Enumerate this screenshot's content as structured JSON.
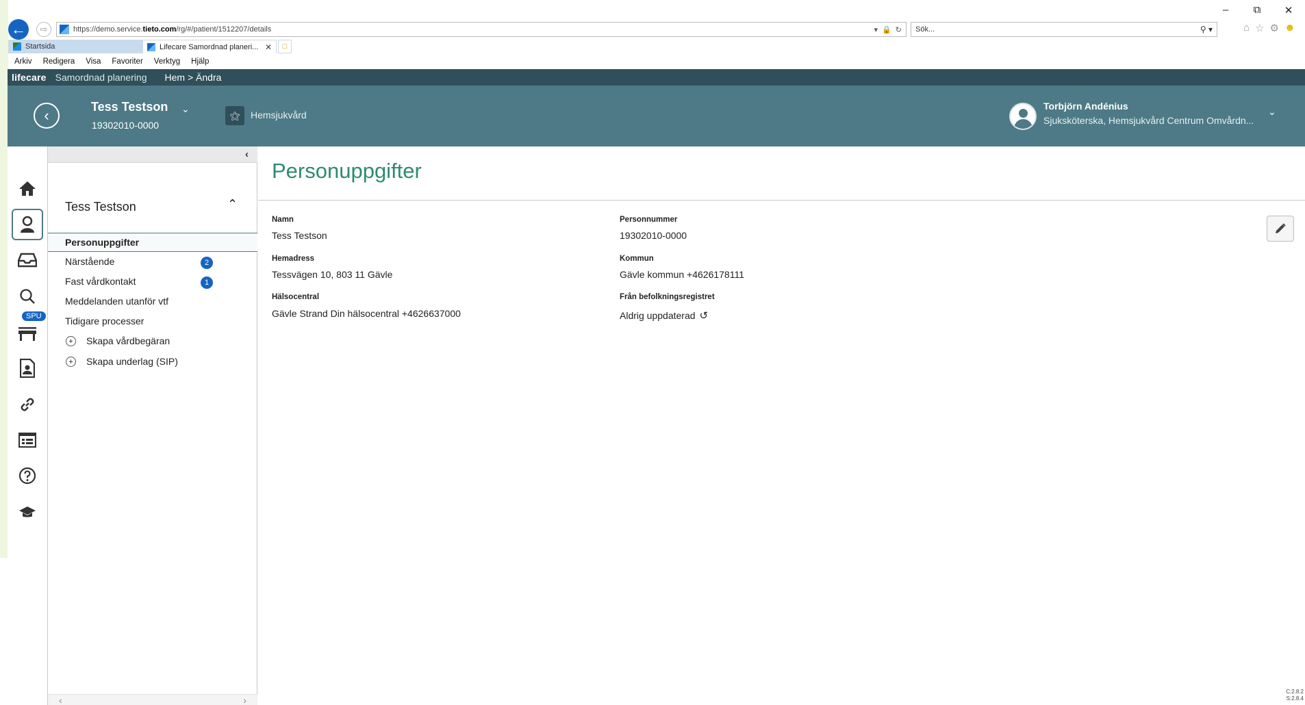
{
  "browser": {
    "url_prefix": "https://demo.service.",
    "url_domain": "tieto.com",
    "url_path": "/rg/#/patient/1512207/details",
    "search_placeholder": "Sök...",
    "tabs": [
      {
        "label": "Startsida"
      },
      {
        "label": "Lifecare Samordnad planeri..."
      }
    ],
    "menu": [
      "Arkiv",
      "Redigera",
      "Visa",
      "Favoriter",
      "Verktyg",
      "Hjälp"
    ]
  },
  "app": {
    "brand": "lifecare",
    "name": "Samordnad planering",
    "breadcrumb": "Hem > Ändra"
  },
  "patient_bar": {
    "name": "Tess Testson",
    "personnummer": "19302010-0000",
    "unit": "Hemsjukvård",
    "user_name": "Torbjörn Andénius",
    "user_role": "Sjuksköterska, Hemsjukvård Centrum Omvårdn..."
  },
  "rail": {
    "spu_badge": "SPU",
    "icons": [
      "home-icon",
      "patient-icon",
      "inbox-icon",
      "search-icon",
      "bed-icon",
      "document-person-icon",
      "link-icon",
      "list-icon",
      "help-icon",
      "graduation-cap-icon"
    ]
  },
  "sidebar": {
    "title": "Tess Testson",
    "items": [
      {
        "label": "Personuppgifter"
      },
      {
        "label": "Närstående",
        "badge": "2"
      },
      {
        "label": "Fast vårdkontakt",
        "badge": "1"
      },
      {
        "label": "Meddelanden utanför vtf"
      },
      {
        "label": "Tidigare processer"
      }
    ],
    "actions": [
      {
        "label": "Skapa vårdbegäran"
      },
      {
        "label": "Skapa underlag (SIP)"
      }
    ]
  },
  "main": {
    "title": "Personuppgifter",
    "fields": {
      "namn": {
        "label": "Namn",
        "value": "Tess Testson"
      },
      "personnummer": {
        "label": "Personnummer",
        "value": "19302010-0000"
      },
      "hemadress": {
        "label": "Hemadress",
        "value": "Tessvägen 10, 803 11 Gävle"
      },
      "kommun": {
        "label": "Kommun",
        "value": "Gävle kommun +4626178111"
      },
      "halsocentral": {
        "label": "Hälsocentral",
        "value": "Gävle Strand Din hälsocentral +4626637000"
      },
      "befolkningsregistret": {
        "label": "Från befolkningsregistret",
        "value": "Aldrig uppdaterad"
      }
    },
    "version_line1": "C:2.8.2",
    "version_line2": "S:2.8.4"
  },
  "colors": {
    "header_dark": "#2f4f5a",
    "header": "#4d7a86",
    "title_green": "#2e8b6f",
    "badge_blue": "#1565c0"
  }
}
